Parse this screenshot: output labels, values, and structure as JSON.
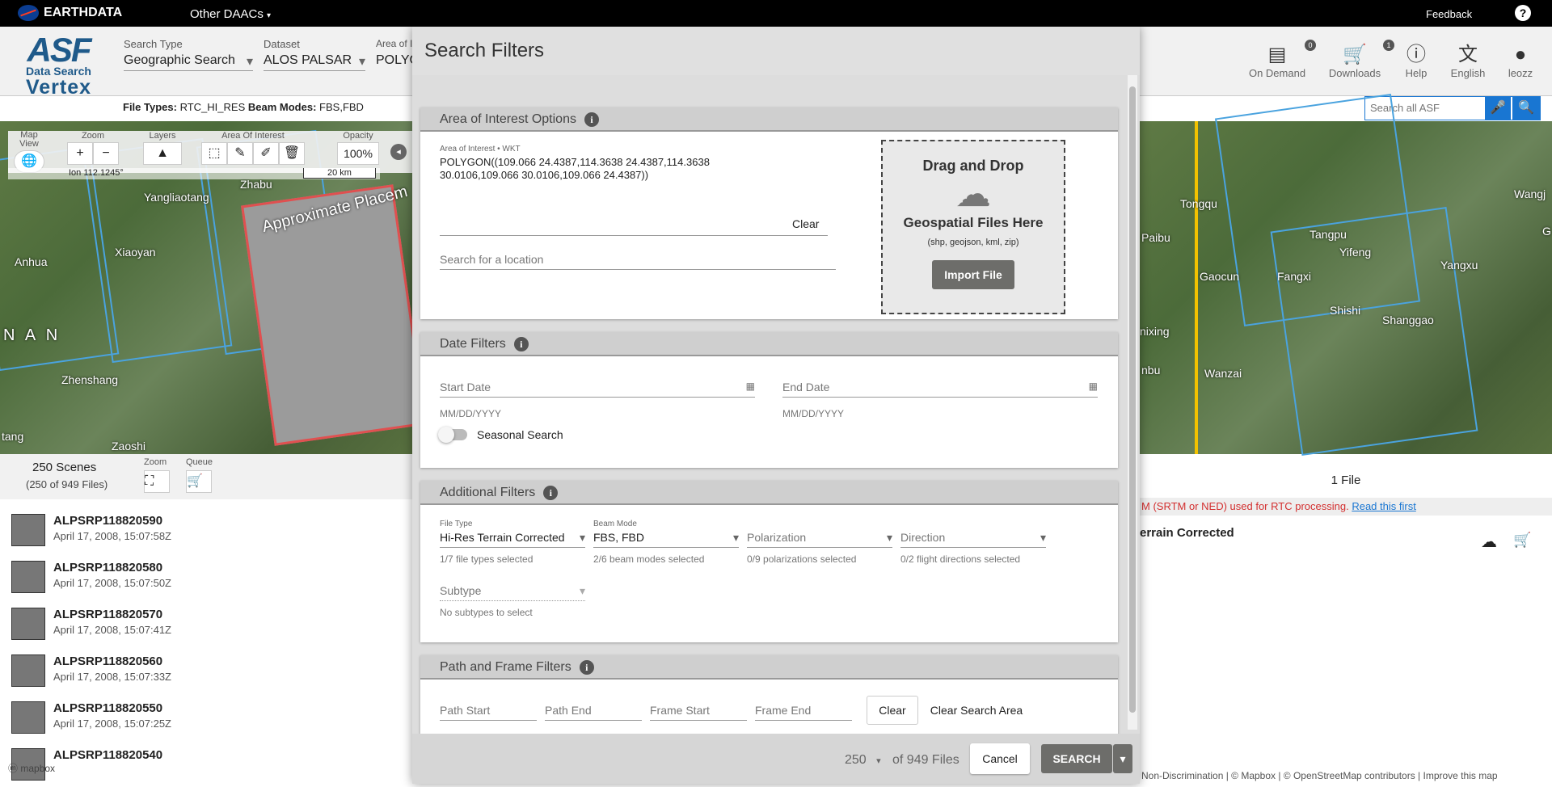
{
  "topbar": {
    "brand": "EARTHDATA",
    "dropdown": "Other DAACs",
    "feedback": "Feedback",
    "help_icon": "?"
  },
  "logo": {
    "asf": "ASF",
    "subtitle": "Data Search",
    "product": "Vertex"
  },
  "header": {
    "search_type_label": "Search Type",
    "search_type_value": "Geographic Search",
    "dataset_label": "Dataset",
    "dataset_value": "ALOS PALSAR",
    "aoi_label": "Area of I",
    "aoi_value": "POLYG",
    "file_types_label": "File Types:",
    "file_types_value": "RTC_HI_RES",
    "beam_modes_label": "Beam Modes:",
    "beam_modes_value": "FBS,FBD",
    "buttons": [
      {
        "label": "On Demand",
        "badge": "0"
      },
      {
        "label": "Downloads",
        "badge": "1"
      },
      {
        "label": "Help",
        "badge": ""
      },
      {
        "label": "English",
        "badge": ""
      },
      {
        "label": "leozz",
        "badge": ""
      }
    ],
    "search_all_placeholder": "Search all ASF"
  },
  "map_toolbar": {
    "map_view": "Map View",
    "zoom": "Zoom",
    "layers": "Layers",
    "aoi": "Area Of Interest",
    "opacity": "Opacity",
    "opacity_value": "100%",
    "lon": "Ion 112.1245°",
    "scale": "20 km"
  },
  "map_labels_left": [
    "Zhabu",
    "Yangliaotang",
    "Anhua",
    "Xiaoyan",
    "N A N",
    "Zhenshang",
    "tang",
    "Zaoshi"
  ],
  "map_overlay_text": "Approximate Placem",
  "map_labels_right": [
    "Tongqu",
    "Wangj",
    "Paibu",
    "Tangpu",
    "G",
    "Yifeng",
    "Yangxu",
    "Gaocun",
    "Fangxi",
    "Shishi",
    "Shanggao",
    "nixing",
    "nbu",
    "Wanzai"
  ],
  "scenes": {
    "count": "250 Scenes",
    "files": "(250 of 949 Files)",
    "zoom": "Zoom",
    "queue": "Queue",
    "items": [
      {
        "name": "ALPSRP118820590",
        "date": "April 17, 2008, 15:07:58Z"
      },
      {
        "name": "ALPSRP118820580",
        "date": "April 17, 2008, 15:07:50Z"
      },
      {
        "name": "ALPSRP118820570",
        "date": "April 17, 2008, 15:07:41Z"
      },
      {
        "name": "ALPSRP118820560",
        "date": "April 17, 2008, 15:07:33Z"
      },
      {
        "name": "ALPSRP118820550",
        "date": "April 17, 2008, 15:07:25Z"
      },
      {
        "name": "ALPSRP118820540",
        "date": ""
      }
    ],
    "mapbox": "mapbox"
  },
  "files_panel": {
    "header": "1 File",
    "warning": "M (SRTM or NED) used for RTC processing.",
    "warning_link": "Read this first",
    "product": "errain Corrected",
    "attribution": "Non-Discrimination | © Mapbox | © OpenStreetMap contributors | Improve this map"
  },
  "dialog": {
    "title": "Search Filters",
    "aoi": {
      "header": "Area of Interest Options",
      "wkt_label": "Area of Interest • WKT",
      "wkt_value": "POLYGON((109.066 24.4387,114.3638 24.4387,114.3638 30.0106,109.066 30.0106,109.066 24.4387))",
      "clear": "Clear",
      "search_location": "Search for a location",
      "drag_title": "Drag and Drop",
      "drag_sub": "Geospatial Files Here",
      "drag_types": "(shp, geojson, kml, zip)",
      "import": "Import File"
    },
    "date": {
      "header": "Date Filters",
      "start": "Start Date",
      "end": "End Date",
      "format": "MM/DD/YYYY",
      "seasonal": "Seasonal Search"
    },
    "additional": {
      "header": "Additional Filters",
      "file_type_label": "File Type",
      "file_type_value": "Hi-Res Terrain Corrected",
      "file_type_hint": "1/7 file types selected",
      "beam_label": "Beam Mode",
      "beam_value": "FBS, FBD",
      "beam_hint": "2/6 beam modes selected",
      "pol_value": "Polarization",
      "pol_hint": "0/9 polarizations selected",
      "dir_value": "Direction",
      "dir_hint": "0/2 flight directions selected",
      "subtype_value": "Subtype",
      "subtype_hint": "No subtypes to select"
    },
    "path": {
      "header": "Path and Frame Filters",
      "path_start": "Path Start",
      "path_end": "Path End",
      "frame_start": "Frame Start",
      "frame_end": "Frame End",
      "clear": "Clear",
      "clear_area": "Clear Search Area"
    },
    "footer": {
      "max": "250",
      "of_files": "of 949 Files",
      "cancel": "Cancel",
      "search": "SEARCH"
    }
  },
  "colors": {
    "accent": "#1976d2",
    "footprint": "#4aa3df",
    "aoi_box": "#e05050",
    "warning": "#d32f2f",
    "search_btn": "#6d6d6a"
  }
}
